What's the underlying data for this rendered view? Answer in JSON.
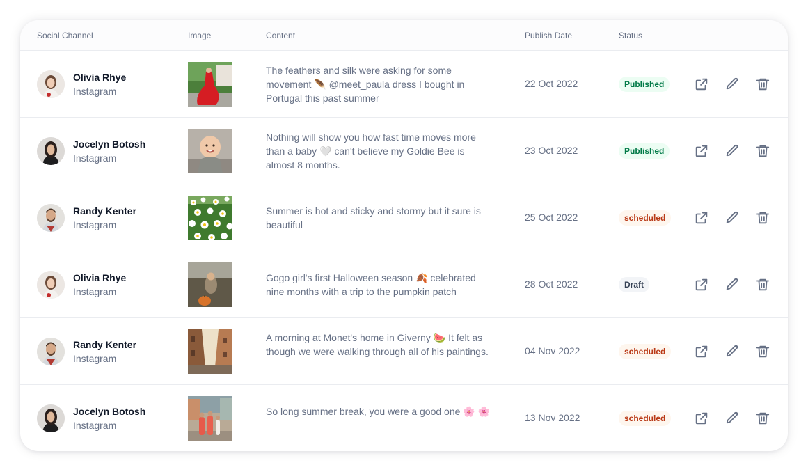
{
  "table": {
    "headers": {
      "channel": "Social Channel",
      "image": "Image",
      "content": "Content",
      "date": "Publish Date",
      "status": "Status"
    },
    "rows": [
      {
        "name": "Olivia Rhye",
        "channel": "Instagram",
        "avatar": "olivia-avatar",
        "image": "woman-red-dress-photo",
        "content": "The feathers and silk were asking for some movement 🪶 @meet_paula dress I bought in Portugal this past summer",
        "date": "22 Oct 2022",
        "status": "Published"
      },
      {
        "name": "Jocelyn Botosh",
        "channel": "Instagram",
        "avatar": "jocelyn-avatar",
        "image": "baby-photo",
        "content": "Nothing will show you how fast time moves more than a baby 🤍 can't believe my Goldie Bee is almost 8 months.",
        "date": "23 Oct 2022",
        "status": "Published"
      },
      {
        "name": "Randy Kenter",
        "channel": "Instagram",
        "avatar": "randy-avatar",
        "image": "daisy-field-photo",
        "content": "Summer is hot and sticky and stormy but it sure is beautiful",
        "date": "25 Oct 2022",
        "status": "scheduled"
      },
      {
        "name": "Olivia Rhye",
        "channel": "Instagram",
        "avatar": "olivia-avatar",
        "image": "pumpkin-patch-photo",
        "content": "Gogo girl's first Halloween season 🍂 celebrated nine months with a trip to the pumpkin patch",
        "date": "28 Oct 2022",
        "status": "Draft"
      },
      {
        "name": "Randy Kenter",
        "channel": "Instagram",
        "avatar": "randy-avatar",
        "image": "giverny-street-photo",
        "content": "A morning at Monet's home in Giverny 🍉 It felt as though we were walking through all of his paintings.",
        "date": "04 Nov 2022",
        "status": "scheduled"
      },
      {
        "name": "Jocelyn Botosh",
        "channel": "Instagram",
        "avatar": "jocelyn-avatar",
        "image": "family-street-photo",
        "content": "So long summer break, you were a good one 🌸 🌸",
        "date": "13 Nov 2022",
        "status": "scheduled"
      }
    ],
    "actions": [
      "external-link-icon",
      "edit-pencil-icon",
      "trash-icon"
    ]
  },
  "colors": {
    "published_bg": "#ecfdf3",
    "published_text": "#027a48",
    "scheduled_bg": "#fef6ee",
    "scheduled_text": "#b93815",
    "draft_bg": "#f2f4f7",
    "draft_text": "#344054"
  }
}
